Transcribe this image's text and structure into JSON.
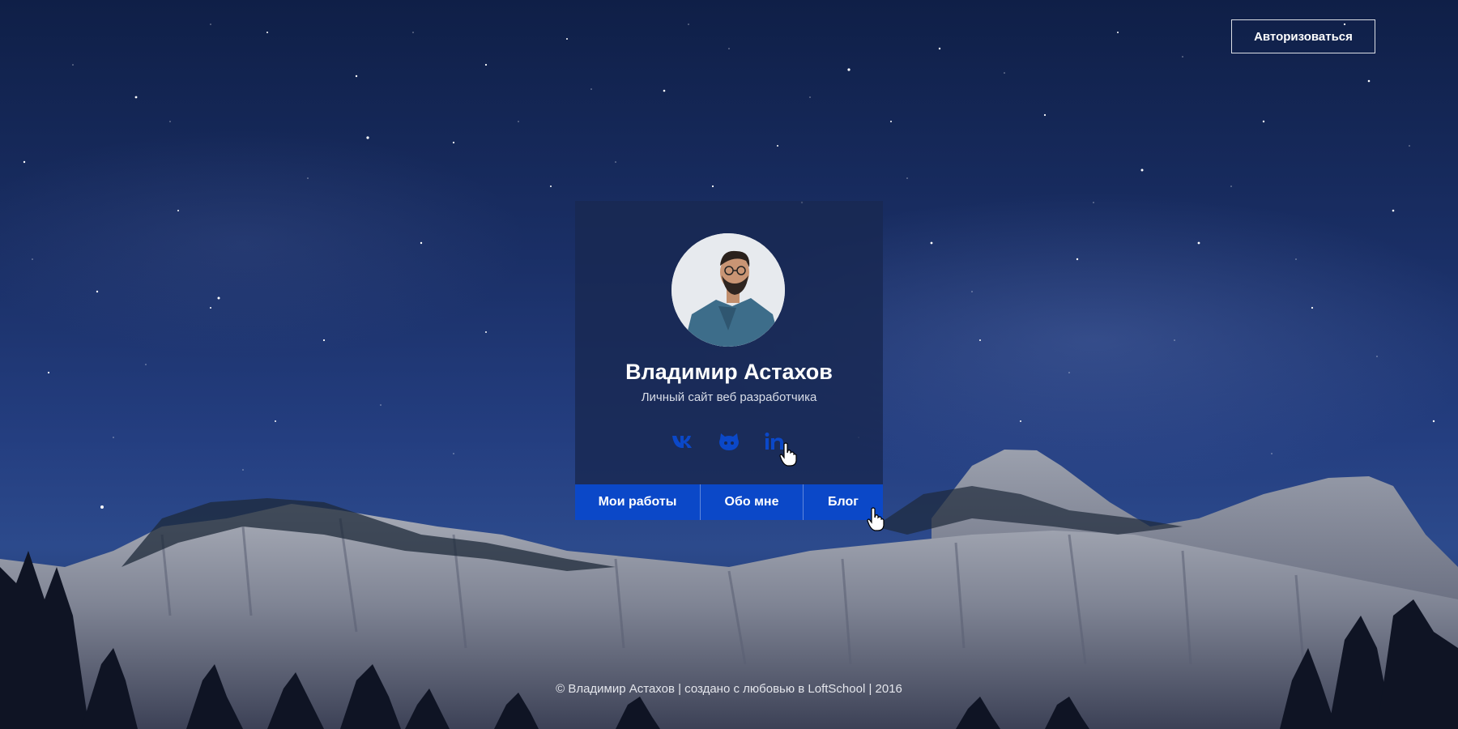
{
  "header": {
    "auth_label": "Авторизоваться"
  },
  "profile": {
    "name": "Владимир Астахов",
    "subtitle": "Личный сайт веб разработчика"
  },
  "socials": [
    {
      "icon": "vk-icon"
    },
    {
      "icon": "github-icon"
    },
    {
      "icon": "linkedin-icon"
    }
  ],
  "nav": {
    "items": [
      {
        "label": "Мои работы"
      },
      {
        "label": "Обо мне"
      },
      {
        "label": "Блог"
      }
    ]
  },
  "footer": {
    "text": "© Владимир Астахов | создано с любовью в LoftSchool | 2016"
  },
  "colors": {
    "accent": "#0b48c8",
    "social_icon": "#0b48c8",
    "card_bg": "#182852"
  }
}
